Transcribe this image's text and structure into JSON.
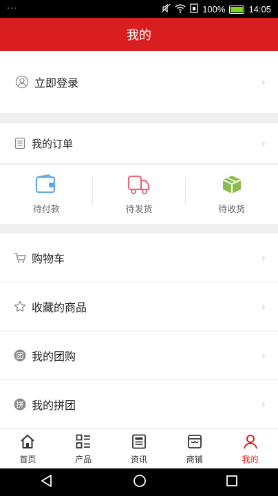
{
  "status_bar": {
    "dots": "···",
    "battery_percent": "100%",
    "time": "14:05"
  },
  "header": {
    "title": "我的"
  },
  "login": {
    "label": "立即登录"
  },
  "orders": {
    "title": "我的订单",
    "items": [
      {
        "label": "待付款",
        "icon": "wallet-icon",
        "color": "#5fa8ea"
      },
      {
        "label": "待发货",
        "icon": "truck-icon",
        "color": "#e56a7a"
      },
      {
        "label": "待收货",
        "icon": "package-icon",
        "color": "#8cbc4f"
      }
    ]
  },
  "menu": [
    {
      "label": "购物车",
      "icon": "cart-icon"
    },
    {
      "label": "收藏的商品",
      "icon": "star-icon"
    },
    {
      "label": "我的团购",
      "icon": "group-buy-icon",
      "icon_text": "团"
    },
    {
      "label": "我的拼团",
      "icon": "pin-group-icon",
      "icon_text": "拼"
    }
  ],
  "tabs": [
    {
      "label": "首页",
      "icon": "home-icon"
    },
    {
      "label": "产品",
      "icon": "grid-icon"
    },
    {
      "label": "资讯",
      "icon": "news-icon"
    },
    {
      "label": "商铺",
      "icon": "store-icon"
    },
    {
      "label": "我的",
      "icon": "user-icon",
      "active": true
    }
  ],
  "colors": {
    "brand": "#d81e1e"
  }
}
